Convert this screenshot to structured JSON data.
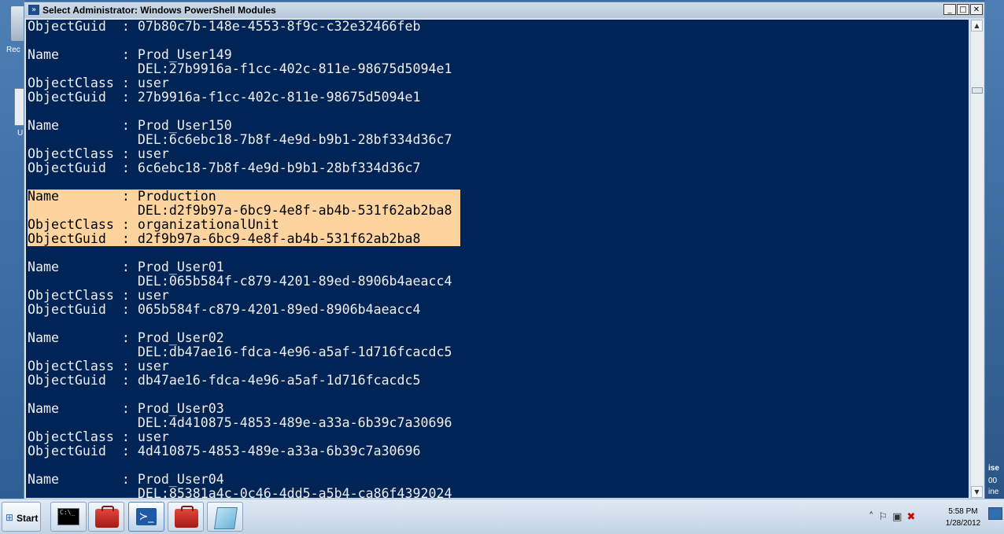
{
  "window": {
    "title": "Select Administrator: Windows PowerShell Modules",
    "controls": {
      "minimize": "_",
      "maximize": "□",
      "close": "✕"
    }
  },
  "desktop": {
    "left_labels": [
      "Rec",
      "U"
    ],
    "right_labels": [
      "ise",
      "00",
      "ine"
    ]
  },
  "console": {
    "lines": [
      "ObjectGuid  : 07b80c7b-148e-4553-8f9c-c32e32466feb",
      "",
      "Name        : Prod_User149",
      "              DEL:27b9916a-f1cc-402c-811e-98675d5094e1",
      "ObjectClass : user",
      "ObjectGuid  : 27b9916a-f1cc-402c-811e-98675d5094e1",
      "",
      "Name        : Prod_User150",
      "              DEL:6c6ebc18-7b8f-4e9d-b9b1-28bf334d36c7",
      "ObjectClass : user",
      "ObjectGuid  : 6c6ebc18-7b8f-4e9d-b9b1-28bf334d36c7",
      "",
      "Name        : Production",
      "              DEL:d2f9b97a-6bc9-4e8f-ab4b-531f62ab2ba8",
      "ObjectClass : organizationalUnit",
      "ObjectGuid  : d2f9b97a-6bc9-4e8f-ab4b-531f62ab2ba8",
      "",
      "Name        : Prod_User01",
      "              DEL:065b584f-c879-4201-89ed-8906b4aeacc4",
      "ObjectClass : user",
      "ObjectGuid  : 065b584f-c879-4201-89ed-8906b4aeacc4",
      "",
      "Name        : Prod_User02",
      "              DEL:db47ae16-fdca-4e96-a5af-1d716fcacdc5",
      "ObjectClass : user",
      "ObjectGuid  : db47ae16-fdca-4e96-a5af-1d716fcacdc5",
      "",
      "Name        : Prod_User03",
      "              DEL:4d410875-4853-489e-a33a-6b39c7a30696",
      "ObjectClass : user",
      "ObjectGuid  : 4d410875-4853-489e-a33a-6b39c7a30696",
      "",
      "Name        : Prod_User04",
      "              DEL:85381a4c-0c46-4dd5-a5b4-ca86f4392024"
    ],
    "selected_line_indices": [
      12,
      13,
      14,
      15
    ],
    "colors": {
      "background": "#012456",
      "text": "#eeedf0",
      "selection": "#fdd49e"
    }
  },
  "scrollbar": {
    "up_arrow": "▲",
    "down_arrow": "▼"
  },
  "taskbar": {
    "start_label": "Start",
    "start_icon": "windows-flag-icon",
    "buttons": [
      {
        "name": "cmd-taskbar-button",
        "icon": "command-prompt-icon",
        "text": "C:\\_"
      },
      {
        "name": "toolbox-taskbar-button-1",
        "icon": "toolbox-icon"
      },
      {
        "name": "powershell-taskbar-button",
        "icon": "powershell-icon",
        "text": "≻_"
      },
      {
        "name": "toolbox-taskbar-button-2",
        "icon": "toolbox-icon"
      },
      {
        "name": "notepad-taskbar-button",
        "icon": "notepad-icon"
      }
    ],
    "tray": {
      "show_hidden": "˄",
      "flag": "⚐",
      "display": "▣",
      "network": "✖"
    },
    "clock": {
      "time": "5:58 PM",
      "date": "1/28/2012"
    }
  }
}
